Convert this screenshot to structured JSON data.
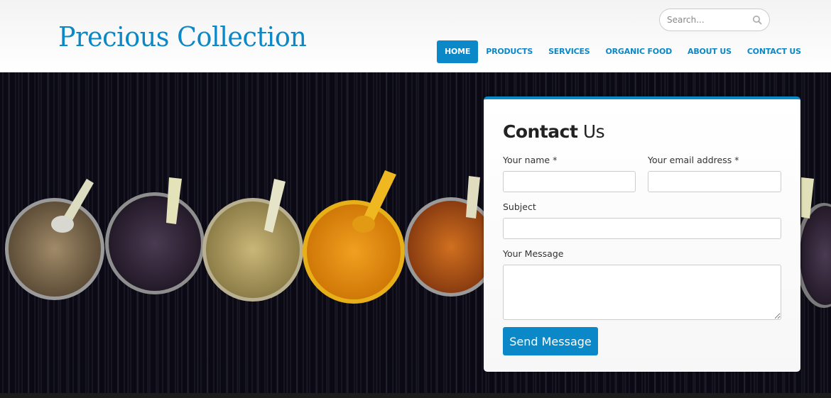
{
  "header": {
    "logo": "Precious Collection",
    "search": {
      "placeholder": "Search...",
      "value": "",
      "icon": "search-icon"
    },
    "nav": [
      {
        "label": "HOME",
        "active": true
      },
      {
        "label": "PRODUCTS",
        "active": false
      },
      {
        "label": "SERVICES",
        "active": false
      },
      {
        "label": "ORGANIC FOOD",
        "active": false
      },
      {
        "label": "ABOUT US",
        "active": false
      },
      {
        "label": "CONTACT US",
        "active": false
      }
    ]
  },
  "hero": {
    "image": "spice-bowls-photo",
    "bowls": [
      "cumin-seeds",
      "mustard-seeds",
      "coriander-powder",
      "turmeric-powder",
      "chili-powder",
      "mustard-seeds"
    ]
  },
  "contact": {
    "title_bold": "Contact",
    "title_light": " Us",
    "name_label": "Your name *",
    "name_value": "",
    "email_label": "Your email address *",
    "email_value": "",
    "subject_label": "Subject",
    "subject_value": "",
    "message_label": "Your Message",
    "message_value": "",
    "send_label": "Send Message"
  },
  "colors": {
    "brand": "#0a88c8",
    "hero_background": "#0b0a14",
    "panel_background": "#ffffff"
  }
}
